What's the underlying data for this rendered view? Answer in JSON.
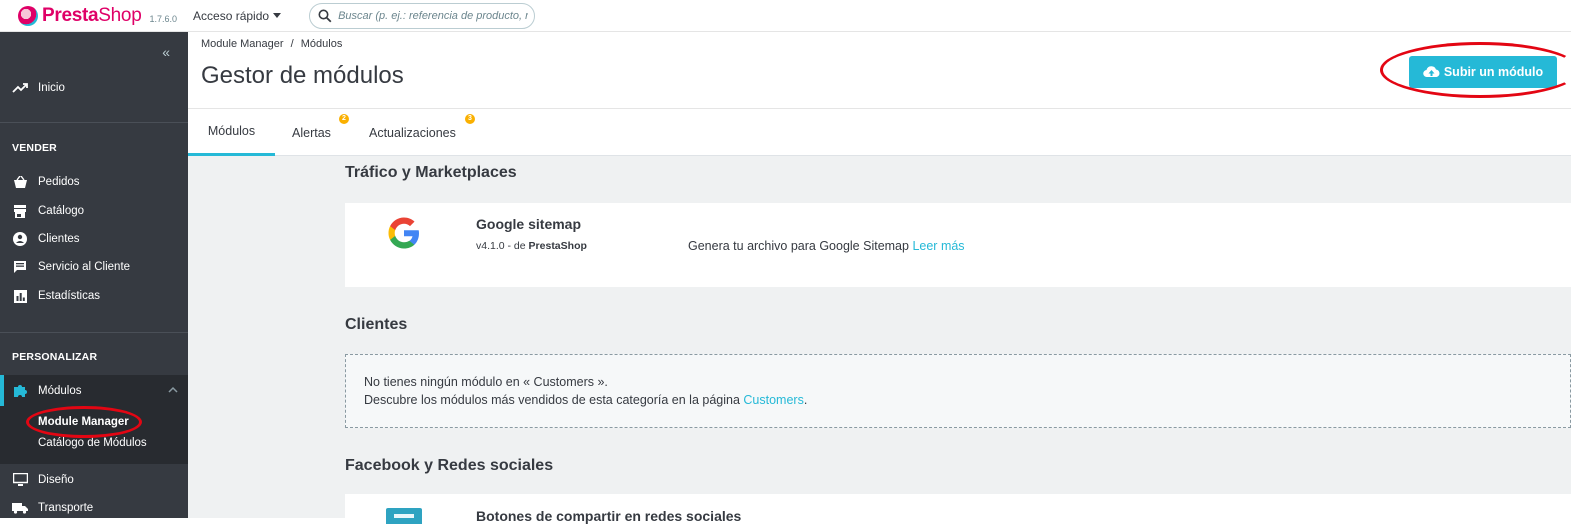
{
  "header": {
    "logo_text_a": "Presta",
    "logo_text_b": "Shop",
    "version": "1.7.6.0",
    "quick_access": "Acceso rápido",
    "search_placeholder": "Buscar (p. ej.: referencia de producto, nombre de cliente...)"
  },
  "sidebar": {
    "inicio": "Inicio",
    "section_sell": "VENDER",
    "sell_items": [
      "Pedidos",
      "Catálogo",
      "Clientes",
      "Servicio al Cliente",
      "Estadísticas"
    ],
    "section_customize": "PERSONALIZAR",
    "modules": "Módulos",
    "sub_items": [
      "Module Manager",
      "Catálogo de Módulos"
    ],
    "after_items": [
      "Diseño",
      "Transporte"
    ]
  },
  "main": {
    "breadcrumb": [
      "Module Manager",
      "Módulos"
    ],
    "breadcrumb_sep": "/",
    "title": "Gestor de módulos",
    "upload_button": "Subir un módulo",
    "tabs": [
      {
        "label": "Módulos",
        "badge": ""
      },
      {
        "label": "Alertas",
        "badge": "2"
      },
      {
        "label": "Actualizaciones",
        "badge": "3"
      }
    ]
  },
  "content": {
    "cat1_title": "Tráfico y Marketplaces",
    "module1": {
      "name": "Google sitemap",
      "version_prefix": "v4.1.0 - de",
      "author": "PrestaShop",
      "description": "Genera tu archivo para Google Sitemap",
      "read_more": "Leer más"
    },
    "cat2_title": "Clientes",
    "empty_line1": "No tienes ningún módulo en « Customers ».",
    "empty_line2_prefix": "Descubre los módulos más vendidos de esta categoría en la página",
    "empty_link": "Customers",
    "empty_line2_suffix": ".",
    "cat3_title": "Facebook y Redes sociales",
    "module2_name": "Botones de compartir en redes sociales"
  },
  "colors": {
    "accent": "#25b9d7",
    "sidebar": "#363a41",
    "brand": "#df0067",
    "badge": "#fab000",
    "annotation": "#e30613"
  }
}
